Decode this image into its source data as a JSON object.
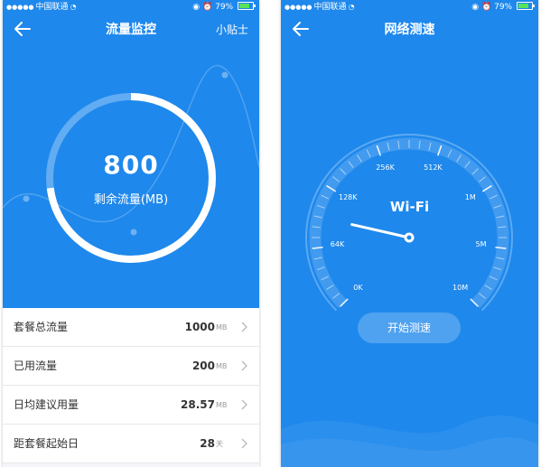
{
  "status_bar": {
    "carrier": "中国联通",
    "battery": "79%",
    "battery_level": 0.79
  },
  "left": {
    "nav": {
      "title": "流量监控",
      "action": "小贴士"
    },
    "gauge": {
      "value": "800",
      "label": "剩余流量(MB)",
      "progress": 0.73
    },
    "stats": [
      {
        "label": "套餐总流量",
        "value": "1000",
        "unit": "MB"
      },
      {
        "label": "已用流量",
        "value": "200",
        "unit": "MB"
      },
      {
        "label": "日均建议用量",
        "value": "28.57",
        "unit": "MB"
      },
      {
        "label": "距套餐起始日",
        "value": "28",
        "unit": "天"
      }
    ]
  },
  "right": {
    "nav": {
      "title": "网络测速"
    },
    "speed": {
      "title": "Wi-Fi",
      "ticks": [
        "0K",
        "64K",
        "128K",
        "256K",
        "512K",
        "1M",
        "5M",
        "10M"
      ],
      "needle_tick_position": 1.5
    },
    "start_button": "开始测速"
  },
  "colors": {
    "primary_blue": "#1e88ec",
    "list_background": "#f3f5f8",
    "battery_green": "#57e35a"
  }
}
